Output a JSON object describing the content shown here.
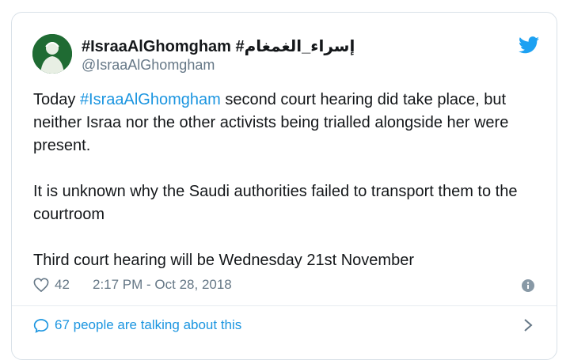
{
  "account": {
    "display_name": "#IsraaAlGhomgham #إسراء_الغمغام",
    "handle": "@IsraaAlGhomgham"
  },
  "tweet": {
    "line1_prefix": "Today ",
    "line1_hashtag": "#IsraaAlGhomgham",
    "line1_rest": " second court hearing did take place, but neither Israa nor the other activists being trialled alongside her were present.",
    "paragraph2": "It is unknown why the Saudi authorities failed to transport them to the courtroom",
    "paragraph3": "Third court hearing will be Wednesday 21st November"
  },
  "meta": {
    "like_count": "42",
    "timestamp": "2:17 PM - Oct 28, 2018"
  },
  "conversation": {
    "label": "67 people are talking about this"
  },
  "colors": {
    "link_blue": "#1b95e0",
    "text": "#14171a",
    "secondary": "#657786",
    "avatar_green": "#1f6b33"
  },
  "icons": {
    "avatar": "avatar",
    "brand": "twitter-bird-icon",
    "like": "heart-icon",
    "info": "info-icon",
    "conversation": "speech-bubble-icon",
    "more": "chevron-right-icon"
  }
}
